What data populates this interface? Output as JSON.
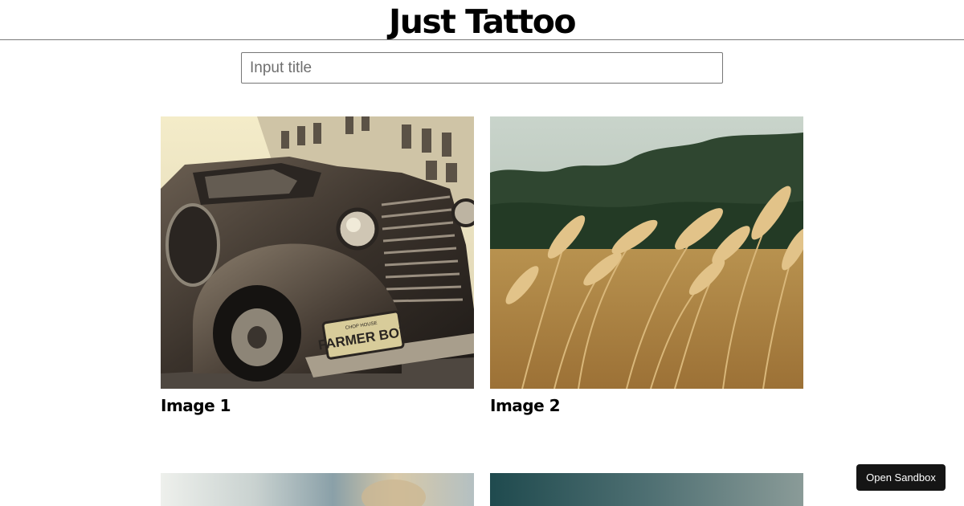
{
  "header": {
    "title": "Just Tattoo"
  },
  "search": {
    "placeholder": "Input title",
    "value": ""
  },
  "gallery": {
    "items": [
      {
        "title": "Image 1",
        "image": "vintage-car-photo"
      },
      {
        "title": "Image 2",
        "image": "wheat-field-photo"
      },
      {
        "title": "",
        "image": "partial-photo-3"
      },
      {
        "title": "",
        "image": "partial-photo-4"
      }
    ]
  },
  "footer": {
    "sandbox_label": "Open Sandbox"
  }
}
